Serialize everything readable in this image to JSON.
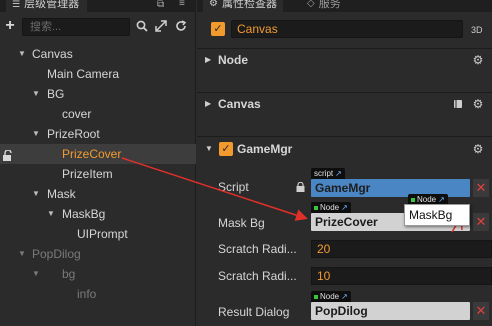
{
  "hierarchy": {
    "tab_title": "层级管理器",
    "search_placeholder": "搜索...",
    "nodes": [
      {
        "label": "Canvas"
      },
      {
        "label": "Main Camera"
      },
      {
        "label": "BG"
      },
      {
        "label": "cover"
      },
      {
        "label": "PrizeRoot"
      },
      {
        "label": "PrizeCover"
      },
      {
        "label": "PrizeItem"
      },
      {
        "label": "Mask"
      },
      {
        "label": "MaskBg"
      },
      {
        "label": "UIPrompt"
      },
      {
        "label": "PopDilog"
      },
      {
        "label": "bg"
      },
      {
        "label": "info"
      }
    ]
  },
  "inspector": {
    "tab_title": "属性检查器",
    "tab_service": "服务",
    "node_name": "Canvas",
    "badge": "3D",
    "sections": {
      "node": "Node",
      "canvas": "Canvas",
      "gamemgr": "GameMgr"
    },
    "props": {
      "script_label": "Script",
      "script_tag": "script",
      "script_value": "GameMgr",
      "maskbg_label": "Mask Bg",
      "maskbg_tag": "Node",
      "maskbg_value": "PrizeCover",
      "scratch1_label": "Scratch Radi...",
      "scratch1_value": "20",
      "scratch2_label": "Scratch Radi...",
      "scratch2_value": "10",
      "result_label": "Result Dialog",
      "result_tag": "Node",
      "result_value": "PopDilog"
    }
  },
  "annotation": {
    "drag_tag": "Node",
    "drag_label": "MaskBg",
    "arrow_color": "#e0302a"
  },
  "colors": {
    "accent": "#f29a2e",
    "panel": "#2b2b2b",
    "script_field": "#4b86c4",
    "node_field": "#d2d2d2",
    "clear": "#e04040"
  }
}
